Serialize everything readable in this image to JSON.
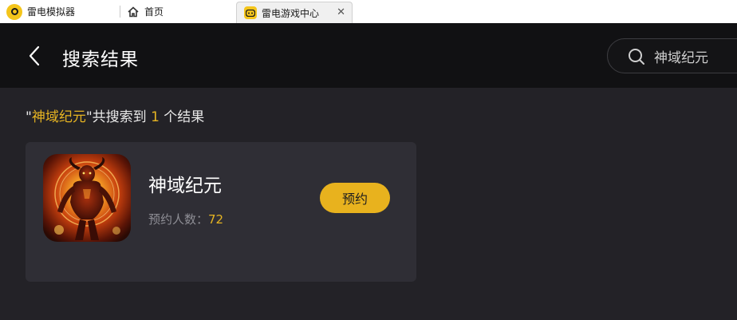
{
  "tabs": [
    {
      "label": "雷电模拟器",
      "icon": "ldplayer-logo-icon"
    },
    {
      "label": "首页",
      "icon": "home-icon"
    },
    {
      "label": "雷电游戏中心",
      "icon": "game-center-icon",
      "active": true
    }
  ],
  "tab_close_glyph": "✕",
  "header": {
    "title": "搜索结果"
  },
  "search": {
    "value": "神域纪元",
    "placeholder": ""
  },
  "summary": {
    "open_quote": "\"",
    "keyword": "神域纪元",
    "mid_text": "\"共搜索到 ",
    "count": "1",
    "suffix": " 个结果"
  },
  "result": {
    "name": "神域纪元",
    "meta_label": "预约人数：",
    "meta_value": "72",
    "action_label": "预约"
  },
  "colors": {
    "accent": "#e6b422",
    "button": "#e8b21e",
    "header_bg": "#111113",
    "page_bg": "#232227",
    "card_bg": "#2f2e35"
  }
}
